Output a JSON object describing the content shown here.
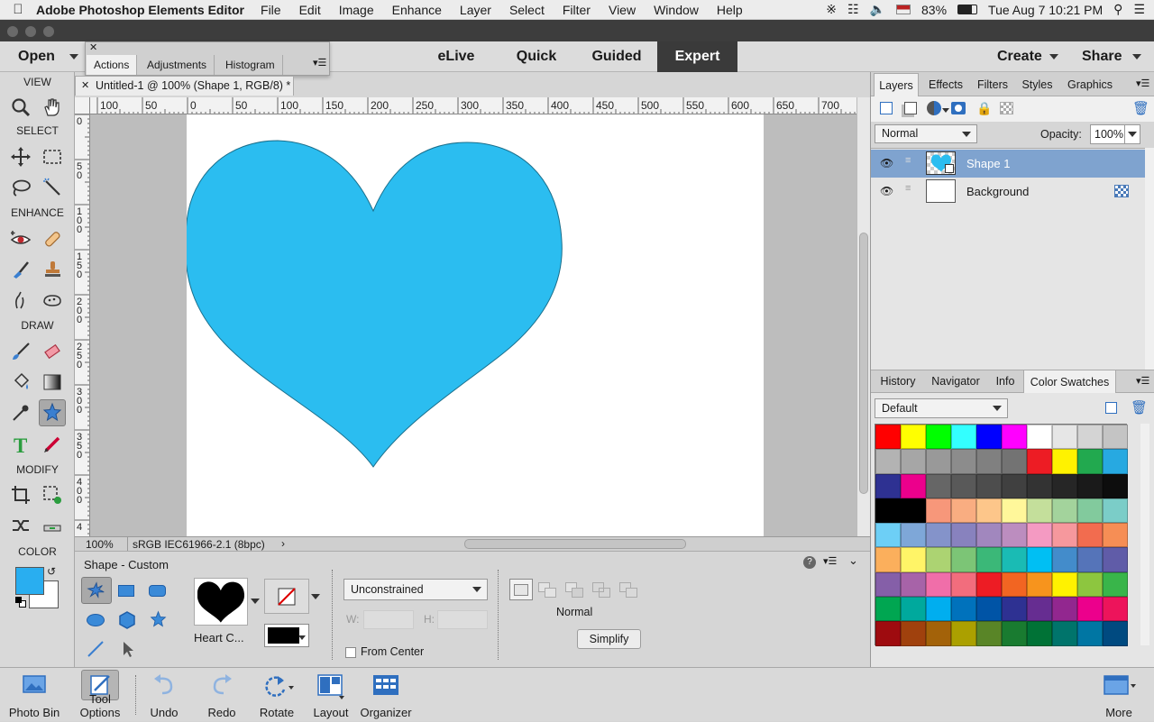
{
  "menubar": {
    "app_name": "Adobe Photoshop Elements Editor",
    "items": [
      "File",
      "Edit",
      "Image",
      "Enhance",
      "Layer",
      "Select",
      "Filter",
      "View",
      "Window",
      "Help"
    ],
    "battery": "83%",
    "clock": "Tue Aug 7  10:21 PM"
  },
  "modebar": {
    "open_label": "Open",
    "modes": [
      "eLive",
      "Quick",
      "Guided",
      "Expert"
    ],
    "active_mode": "Expert",
    "create_label": "Create",
    "share_label": "Share"
  },
  "float_panel": {
    "tabs": [
      "Actions",
      "Adjustments",
      "Histogram"
    ],
    "active_tab": "Actions"
  },
  "toolbox": {
    "sections": [
      "VIEW",
      "SELECT",
      "ENHANCE",
      "DRAW",
      "MODIFY",
      "COLOR"
    ],
    "foreground_color": "#29aef0",
    "background_color": "#ffffff"
  },
  "document": {
    "tab_title": "Untitled-1 @ 100% (Shape 1, RGB/8) *",
    "ruler_h": [
      "100",
      "50",
      "0",
      "50",
      "100",
      "150",
      "200",
      "250",
      "300",
      "350",
      "400",
      "450",
      "500",
      "550",
      "600",
      "650",
      "700"
    ],
    "ruler_v": [
      "0",
      "5\n0",
      "1\n0\n0",
      "1\n5\n0",
      "2\n0\n0",
      "2\n5\n0",
      "3\n0\n0",
      "3\n5\n0",
      "4\n0\n0",
      "4"
    ],
    "zoom": "100%",
    "color_profile": "sRGB IEC61966-2.1 (8bpc)",
    "shape_color": "#2bbdf0"
  },
  "tool_options": {
    "title": "Shape - Custom",
    "shape_name": "Heart C...",
    "constraint": "Unconstrained",
    "w_label": "W:",
    "h_label": "H:",
    "from_center": "From Center",
    "mode_label": "Normal",
    "simplify": "Simplify"
  },
  "layers_panel": {
    "tabs": [
      "Layers",
      "Effects",
      "Filters",
      "Styles",
      "Graphics"
    ],
    "active_tab": "Layers",
    "blend_mode": "Normal",
    "opacity_label": "Opacity:",
    "opacity_value": "100%",
    "layers": [
      {
        "name": "Shape 1",
        "selected": true
      },
      {
        "name": "Background",
        "selected": false
      }
    ]
  },
  "swatches_panel": {
    "tabs": [
      "History",
      "Navigator",
      "Info",
      "Color Swatches"
    ],
    "active_tab": "Color Swatches",
    "preset": "Default",
    "colors": [
      "#ff0000",
      "#ffff00",
      "#00ff00",
      "#33ffff",
      "#0000ff",
      "#ff00ff",
      "#ffffff",
      "#e6e6e6",
      "#d4d4d4",
      "#c4c4c4",
      "#b3b3b3",
      "#a6a6a6",
      "#999999",
      "#8c8c8c",
      "#808080",
      "#737373",
      "#ed1c24",
      "#fff200",
      "#22a94f",
      "#27a9e1",
      "#2e3192",
      "#ec008c",
      "#666666",
      "#595959",
      "#4d4d4d",
      "#404040",
      "#333333",
      "#262626",
      "#1a1a1a",
      "#0d0d0d",
      "#000000",
      "#000000",
      "#f7977a",
      "#f9ad81",
      "#fdc68a",
      "#fff79a",
      "#c4df9b",
      "#a3d39c",
      "#82ca9d",
      "#7bcdc8",
      "#6dcff6",
      "#7ea7d8",
      "#8493ca",
      "#8882be",
      "#a187be",
      "#bc8dbf",
      "#f49ac2",
      "#f6989d",
      "#f26c4f",
      "#f68e55",
      "#fbaf5c",
      "#fff467",
      "#acd372",
      "#7cc576",
      "#3bb878",
      "#1abbb4",
      "#00bff3",
      "#438ccb",
      "#5574b9",
      "#605ca8",
      "#855fa8",
      "#a763a8",
      "#f06ea9",
      "#f26d7d",
      "#ed1c24",
      "#f26522",
      "#f7941d",
      "#fff200",
      "#8dc63f",
      "#39b54a",
      "#00a651",
      "#00a99d",
      "#00aeef",
      "#0072bc",
      "#0054a6",
      "#2e3192",
      "#662d91",
      "#92278f",
      "#ec008c",
      "#ed145b",
      "#9e0b0f",
      "#a0410d",
      "#a36209",
      "#aba000",
      "#598527",
      "#197b30",
      "#007236",
      "#00746b",
      "#0076a3",
      "#004a80"
    ]
  },
  "bottombar": {
    "items": [
      "Photo Bin",
      "Tool Options",
      "Undo",
      "Redo",
      "Rotate",
      "Layout",
      "Organizer"
    ],
    "more": "More"
  }
}
